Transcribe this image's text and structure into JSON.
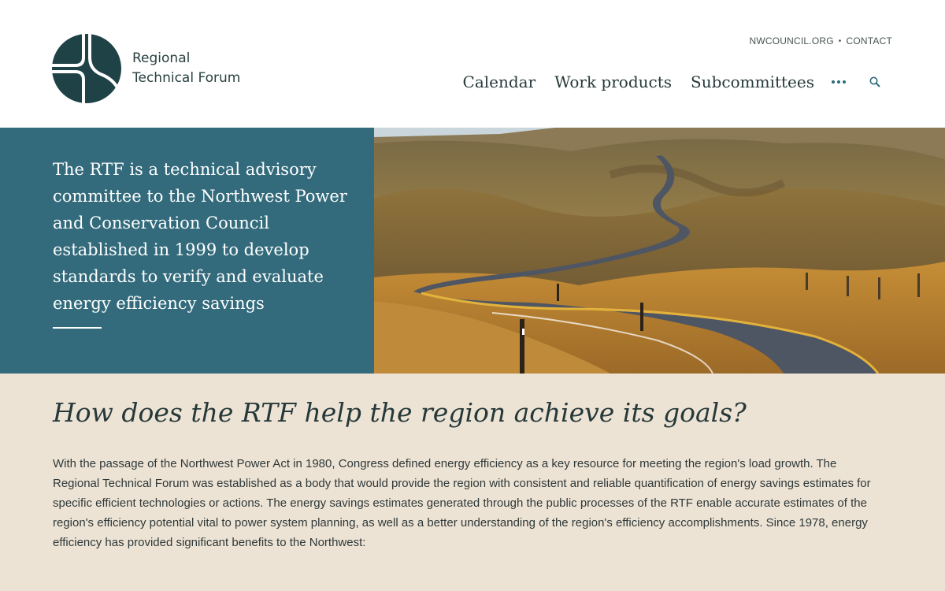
{
  "header": {
    "logo": {
      "line1": "Regional",
      "line2": "Technical Forum"
    },
    "utility": {
      "link1": "NWCOUNCIL.ORG",
      "separator": "•",
      "link2": "CONTACT"
    },
    "nav": {
      "items": [
        "Calendar",
        "Work products",
        "Subcommittees"
      ],
      "more_icon": "ellipsis-icon",
      "search_icon": "search-icon"
    }
  },
  "hero": {
    "text": "The RTF is a technical advisory committee to the Northwest Power and Conservation Council established in 1999 to develop standards to verify and evaluate energy efficiency savings",
    "image": "winding-road-landscape"
  },
  "content": {
    "heading": "How does the RTF help the region achieve its goals?",
    "paragraph": "With the passage of the Northwest Power Act in 1980, Congress defined energy efficiency as a key resource for meeting the region's load growth. The Regional Technical Forum was established as a body that would provide the region with consistent and reliable quantification of energy savings estimates for specific efficient technologies or actions. The energy savings estimates generated through the public processes of the RTF enable accurate estimates of the region's efficiency potential vital to power system planning, as well as a better understanding of the region's efficiency accomplishments. Since 1978, energy efficiency has provided significant benefits to the Northwest:"
  },
  "colors": {
    "hero_bg": "#336b7c",
    "content_bg": "#ede3d5",
    "logo": "#1f4246",
    "text": "#26393a"
  }
}
